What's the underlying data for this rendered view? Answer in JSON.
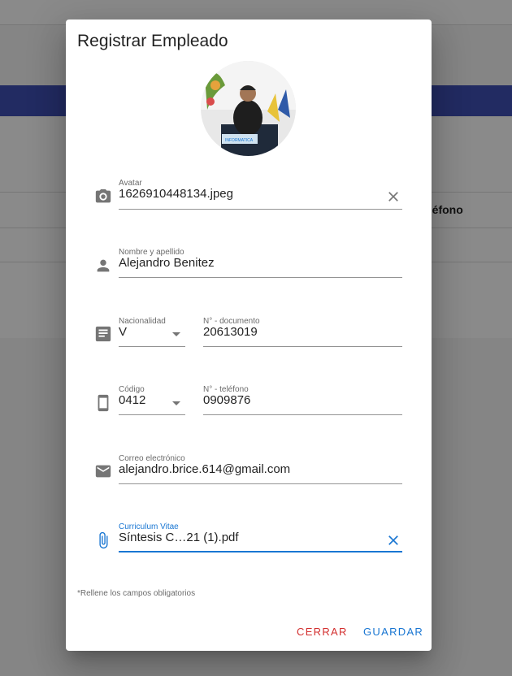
{
  "background": {
    "column_header": "eléfono"
  },
  "dialog": {
    "title": "Registrar Empleado",
    "avatar_alt": "employee-photo",
    "fields": {
      "avatar": {
        "label": "Avatar",
        "value": "1626910448134.jpeg",
        "icon": "camera-icon"
      },
      "name": {
        "label": "Nombre y apellido",
        "value": "Alejandro Benitez",
        "icon": "person-icon"
      },
      "nationality": {
        "label": "Nacionalidad",
        "value": "V",
        "icon": "id-card-icon"
      },
      "document": {
        "label": "N° - documento",
        "value": "20613019"
      },
      "phone_code": {
        "label": "Código",
        "value": "0412",
        "icon": "phone-icon"
      },
      "phone": {
        "label": "N° - teléfono",
        "value": "0909876"
      },
      "email": {
        "label": "Correo electrónico",
        "value": "alejandro.brice.614@gmail.com",
        "icon": "mail-icon"
      },
      "cv": {
        "label": "Curriculum Vitae",
        "value": "Síntesis C…21 (1).pdf",
        "icon": "paperclip-icon"
      }
    },
    "required_note": "*Rellene los campos obligatorios",
    "buttons": {
      "close": "CERRAR",
      "save": "GUARDAR"
    },
    "colors": {
      "primary": "#1976d2",
      "danger": "#d32f2f"
    }
  }
}
